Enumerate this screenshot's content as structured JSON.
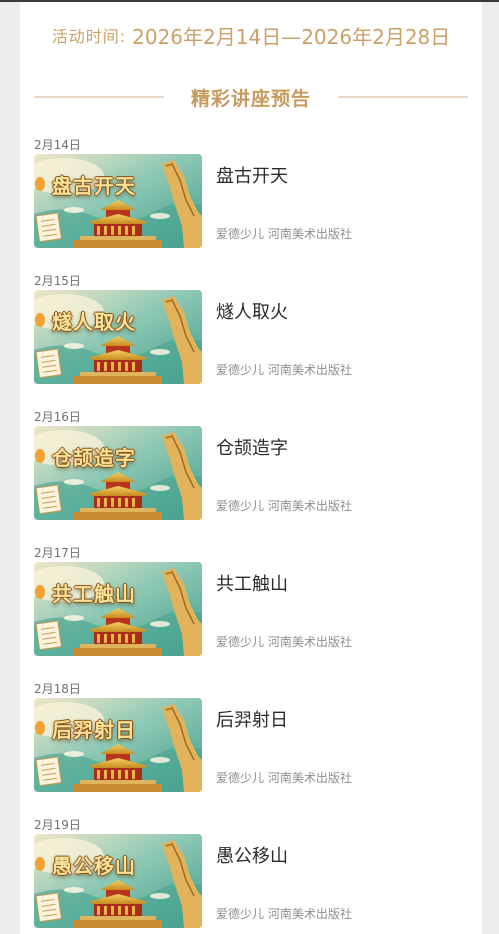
{
  "header": {
    "activity_label": "活动时间:",
    "activity_dates": "2026年2月14日—2026年2月28日"
  },
  "section": {
    "title": "精彩讲座预告"
  },
  "lectures": [
    {
      "date": "2月14日",
      "title": "盘古开天",
      "thumb_title": "盘古开天",
      "author": "爱德少儿",
      "publisher": "河南美术出版社"
    },
    {
      "date": "2月15日",
      "title": "燧人取火",
      "thumb_title": "燧人取火",
      "author": "爱德少儿",
      "publisher": "河南美术出版社"
    },
    {
      "date": "2月16日",
      "title": "仓颉造字",
      "thumb_title": "仓颉造字",
      "author": "爱德少儿",
      "publisher": "河南美术出版社"
    },
    {
      "date": "2月17日",
      "title": "共工触山",
      "thumb_title": "共工触山",
      "author": "爱德少儿",
      "publisher": "河南美术出版社"
    },
    {
      "date": "2月18日",
      "title": "后羿射日",
      "thumb_title": "后羿射日",
      "author": "爱德少儿",
      "publisher": "河南美术出版社"
    },
    {
      "date": "2月19日",
      "title": "愚公移山",
      "thumb_title": "愚公移山",
      "author": "爱德少儿",
      "publisher": "河南美术出版社"
    }
  ],
  "colors": {
    "accent": "#c79a5d",
    "date_text": "#caa167",
    "thumb_teal": "#5fb3a0",
    "thumb_gold": "#e9b44c"
  }
}
